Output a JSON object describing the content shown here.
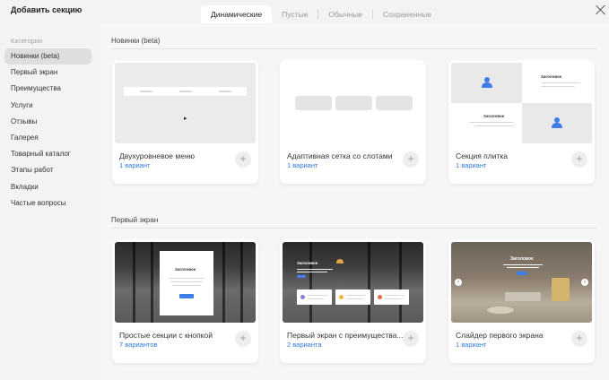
{
  "header": {
    "title": "Добавить секцию",
    "tabs": [
      {
        "label": "Динамические",
        "active": true
      },
      {
        "label": "Пустые",
        "active": false
      },
      {
        "label": "Обычные",
        "active": false
      },
      {
        "label": "Сохраненные",
        "active": false
      }
    ],
    "close_icon": "close-icon"
  },
  "sidebar": {
    "caption": "Категории",
    "items": [
      {
        "label": "Новинки (beta)",
        "active": true
      },
      {
        "label": "Первый экран"
      },
      {
        "label": "Преимущества"
      },
      {
        "label": "Услуги"
      },
      {
        "label": "Отзывы"
      },
      {
        "label": "Галерея"
      },
      {
        "label": "Товарный каталог"
      },
      {
        "label": "Этапы работ"
      },
      {
        "label": "Вкладки"
      },
      {
        "label": "Частые вопросы"
      }
    ]
  },
  "sections": [
    {
      "title": "Новинки (beta)",
      "cards": [
        {
          "name": "Двухуровневое меню",
          "variants": "1 вариант"
        },
        {
          "name": "Адаптивная сетка со слотами",
          "variants": "1 вариант"
        },
        {
          "name": "Секция плитка",
          "variants": "1 вариант",
          "thumb_titles": [
            "Заголовок",
            "Заголовок"
          ]
        }
      ]
    },
    {
      "title": "Первый экран",
      "cards": [
        {
          "name": "Простые секции с кнопкой",
          "variants": "7 вариантов",
          "thumb_title": "Заголовок"
        },
        {
          "name": "Первый экран с преимущества...",
          "variants": "2 варианта",
          "thumb_title": "Заголовок"
        },
        {
          "name": "Слайдер первого экрана",
          "variants": "1 вариант",
          "thumb_title": "Заголовок"
        }
      ]
    }
  ],
  "add_button_label": "+",
  "colors": {
    "accent": "#2c78e4",
    "icon_blue": "#3f7ee8",
    "background": "#f3f3f4"
  }
}
